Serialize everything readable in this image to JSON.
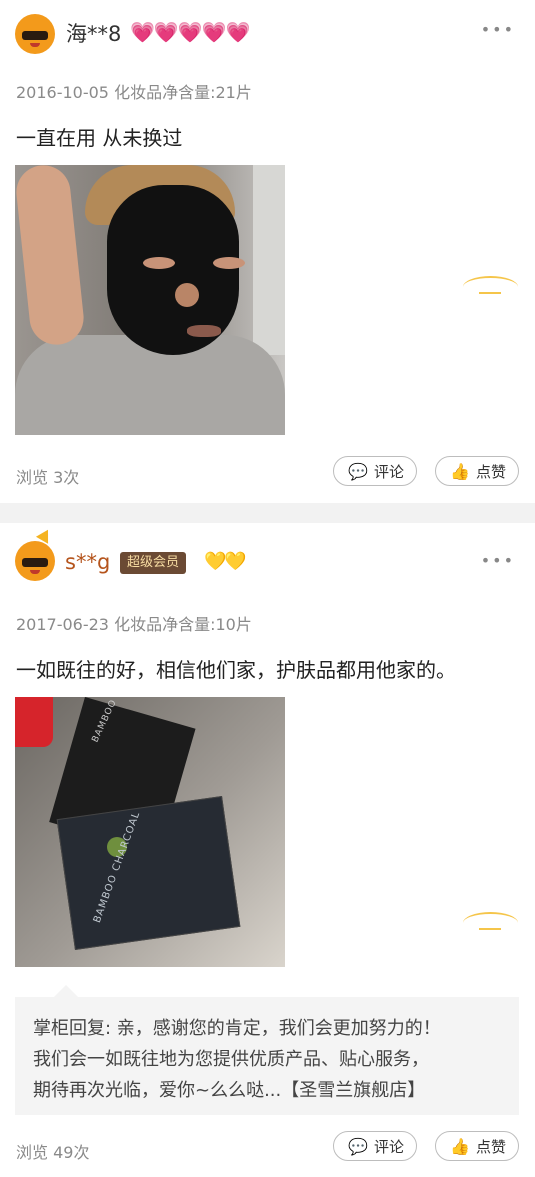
{
  "reviews": [
    {
      "username": "海**8",
      "level_badge": "💗💗💗💗💗",
      "more": "•••",
      "meta": "2016-10-05 化妆品净含量:21片",
      "content": "一直在用 从未换过",
      "views": "浏览 3次",
      "comment_label": "评论",
      "like_label": "点赞"
    },
    {
      "username": "s**g",
      "vip_badge": "超级会员",
      "level_badge": "💛💛",
      "more": "•••",
      "meta": "2017-06-23 化妆品净含量:10片",
      "content": "一如既往的好，相信他们家，护肤品都用他家的。",
      "photo_texts": [
        "BAMBOO CHARCOAL",
        "BAMBOO CHARCOAL"
      ],
      "reply_lines": [
        "掌柜回复: 亲，感谢您的肯定，我们会更加努力的！",
        "我们会一如既往地为您提供优质产品、贴心服务，",
        "期待再次光临，爱你~么么哒...【圣雪兰旗舰店】"
      ],
      "views": "浏览 49次",
      "comment_label": "评论",
      "like_label": "点赞"
    }
  ],
  "icons": {
    "comment": "comment-icon",
    "like": "thumbs-up-icon",
    "more": "more-icon"
  },
  "colors": {
    "accent": "#f5c54a",
    "vip_bg": "#6b4a34",
    "vip_text": "#f7dca2",
    "heart": "#f0506e",
    "diamond": "#f3b31a"
  }
}
